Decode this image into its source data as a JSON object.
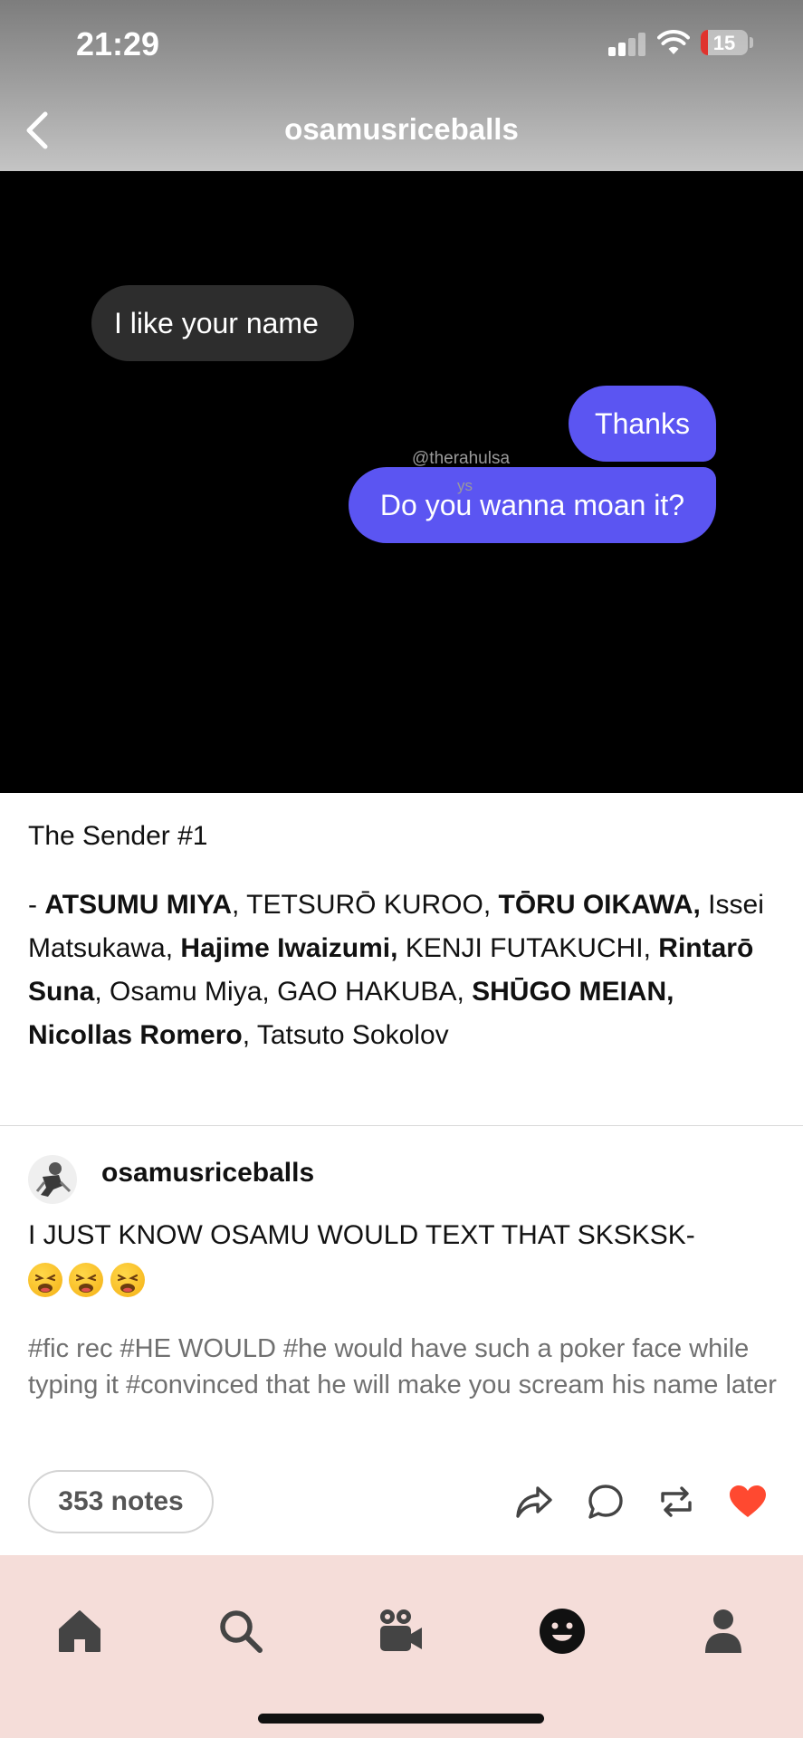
{
  "status_bar": {
    "time": "21:29",
    "battery_text": "15",
    "battery_level_percent": 15,
    "signal_bars_active": 2,
    "icons": [
      "signal-icon",
      "wifi-icon",
      "battery-icon"
    ]
  },
  "header": {
    "title": "osamusriceballs",
    "back_icon": "chevron-left-icon"
  },
  "image": {
    "bubble_received": "I like your name",
    "bubble_sent_1": "Thanks",
    "bubble_sent_2": "Do you wanna moan it?",
    "watermark_line1": "@therahulsa",
    "watermark_line2": "ys"
  },
  "post": {
    "title": "The Sender #1",
    "list": [
      {
        "text": "- ",
        "bold": false
      },
      {
        "text": "ATSUMU MIYA",
        "bold": true
      },
      {
        "text": ", TETSURŌ KUROO, ",
        "bold": false
      },
      {
        "text": "TŌRU OIKAWA,",
        "bold": true
      },
      {
        "text": " Issei Matsukawa, ",
        "bold": false
      },
      {
        "text": "Hajime Iwaizumi,",
        "bold": true
      },
      {
        "text": " KENJI FUTAKUCHI, ",
        "bold": false
      },
      {
        "text": "Rintarō Suna",
        "bold": true
      },
      {
        "text": ", Osamu Miya, GAO HAKUBA, ",
        "bold": false
      },
      {
        "text": "SHŪGO MEIAN, Nicollas Romero",
        "bold": true
      },
      {
        "text": ", Tatsuto Sokolov",
        "bold": false
      }
    ]
  },
  "reblog": {
    "username": "osamusriceballs",
    "text": "I JUST KNOW OSAMU WOULD TEXT THAT SKSKSK-",
    "emoji_count": 3,
    "emoji_name": "weary-face-emoji"
  },
  "tags": "#fic rec  #HE WOULD  #he would have such a poker face while typing it  #convinced that he will make you scream his name later",
  "actions": {
    "notes_label": "353 notes",
    "icons": [
      "share-icon",
      "reply-icon",
      "reblog-icon",
      "like-icon"
    ],
    "like_color": "#ff4930"
  },
  "tabbar": {
    "icons": [
      "home-icon",
      "search-icon",
      "video-icon",
      "activity-icon",
      "account-icon"
    ],
    "background": "#f5ddd9"
  }
}
